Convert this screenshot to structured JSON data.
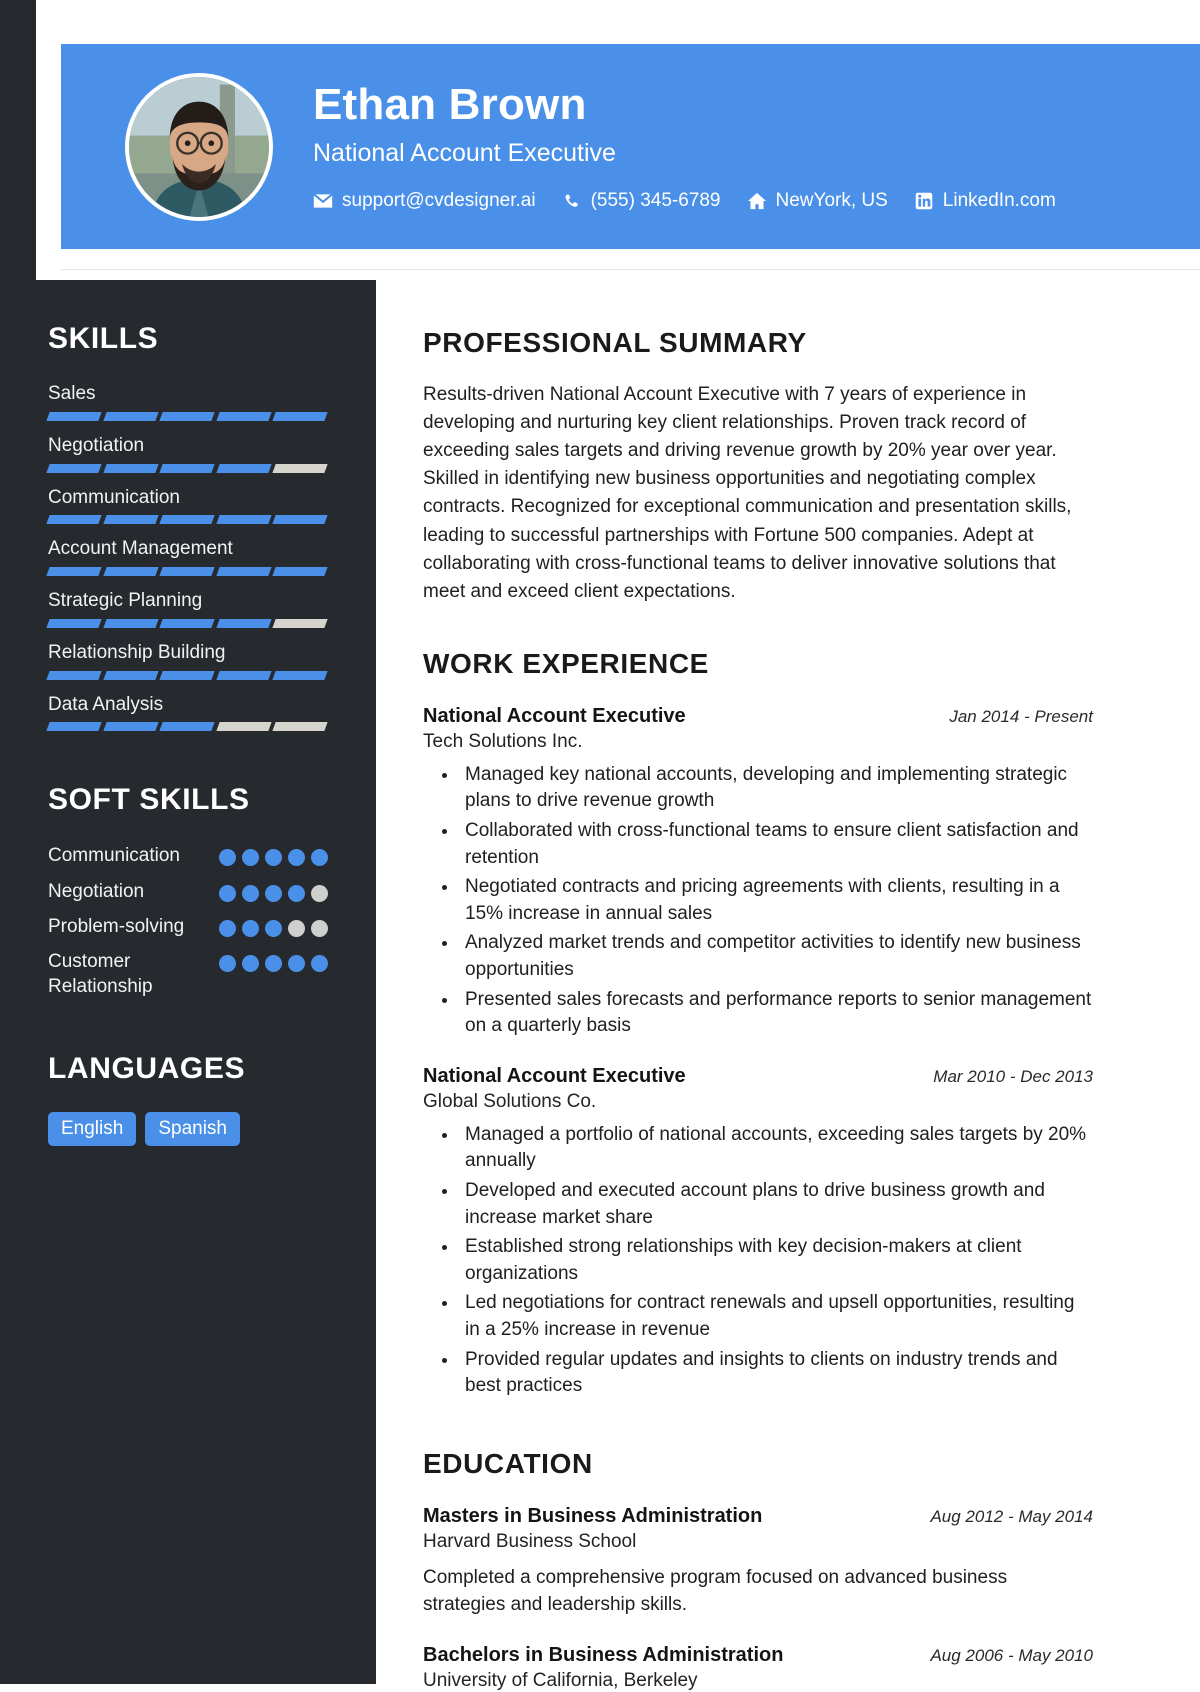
{
  "theme": {
    "accent": "#4a90e8",
    "sidebar_bg": "#26292d",
    "muted_bar": "#d5d5ce"
  },
  "header": {
    "name": "Ethan Brown",
    "role": "National Account Executive",
    "contacts": [
      {
        "icon": "envelope-icon",
        "label": "support@cvdesigner.ai"
      },
      {
        "icon": "phone-icon",
        "label": "(555) 345-6789"
      },
      {
        "icon": "home-icon",
        "label": "NewYork, US"
      },
      {
        "icon": "linkedin-icon",
        "label": "LinkedIn.com"
      }
    ]
  },
  "sidebar": {
    "skills_heading": "SKILLS",
    "skills": [
      {
        "name": "Sales",
        "level": 5,
        "max": 5
      },
      {
        "name": "Negotiation",
        "level": 4,
        "max": 5
      },
      {
        "name": "Communication",
        "level": 5,
        "max": 5
      },
      {
        "name": "Account Management",
        "level": 5,
        "max": 5
      },
      {
        "name": "Strategic Planning",
        "level": 4,
        "max": 5
      },
      {
        "name": "Relationship Building",
        "level": 5,
        "max": 5
      },
      {
        "name": "Data Analysis",
        "level": 3,
        "max": 5
      }
    ],
    "soft_skills_heading": "SOFT SKILLS",
    "soft_skills": [
      {
        "name": "Communication",
        "level": 5,
        "max": 5
      },
      {
        "name": "Negotiation",
        "level": 4,
        "max": 5
      },
      {
        "name": "Problem-solving",
        "level": 3,
        "max": 5
      },
      {
        "name": "Customer Relationship",
        "level": 5,
        "max": 5
      }
    ],
    "languages_heading": "LANGUAGES",
    "languages": [
      "English",
      "Spanish"
    ]
  },
  "main": {
    "summary_heading": "PROFESSIONAL SUMMARY",
    "summary_text": "Results-driven National Account Executive with 7 years of experience in developing and nurturing key client relationships. Proven track record of exceeding sales targets and driving revenue growth by 20% year over year. Skilled in identifying new business opportunities and negotiating complex contracts. Recognized for exceptional communication and presentation skills, leading to successful partnerships with Fortune 500 companies. Adept at collaborating with cross-functional teams to deliver innovative solutions that meet and exceed client expectations.",
    "work_heading": "WORK EXPERIENCE",
    "work": [
      {
        "title": "National Account Executive",
        "date": "Jan 2014 - Present",
        "org": "Tech Solutions Inc.",
        "bullets": [
          "Managed key national accounts, developing and implementing strategic plans to drive revenue growth",
          "Collaborated with cross-functional teams to ensure client satisfaction and retention",
          "Negotiated contracts and pricing agreements with clients, resulting in a 15% increase in annual sales",
          "Analyzed market trends and competitor activities to identify new business opportunities",
          "Presented sales forecasts and performance reports to senior management on a quarterly basis"
        ]
      },
      {
        "title": "National Account Executive",
        "date": "Mar 2010 - Dec 2013",
        "org": "Global Solutions Co.",
        "bullets": [
          "Managed a portfolio of national accounts, exceeding sales targets by 20% annually",
          "Developed and executed account plans to drive business growth and increase market share",
          "Established strong relationships with key decision-makers at client organizations",
          "Led negotiations for contract renewals and upsell opportunities, resulting in a 25% increase in revenue",
          "Provided regular updates and insights to clients on industry trends and best practices"
        ]
      }
    ],
    "education_heading": "EDUCATION",
    "education": [
      {
        "title": "Masters in Business Administration",
        "date": "Aug 2012 - May 2014",
        "org": "Harvard Business School",
        "desc": "Completed a comprehensive program focused on advanced business strategies and leadership skills."
      },
      {
        "title": "Bachelors in Business Administration",
        "date": "Aug 2006 - May 2010",
        "org": "University of California, Berkeley",
        "desc": ""
      }
    ]
  }
}
